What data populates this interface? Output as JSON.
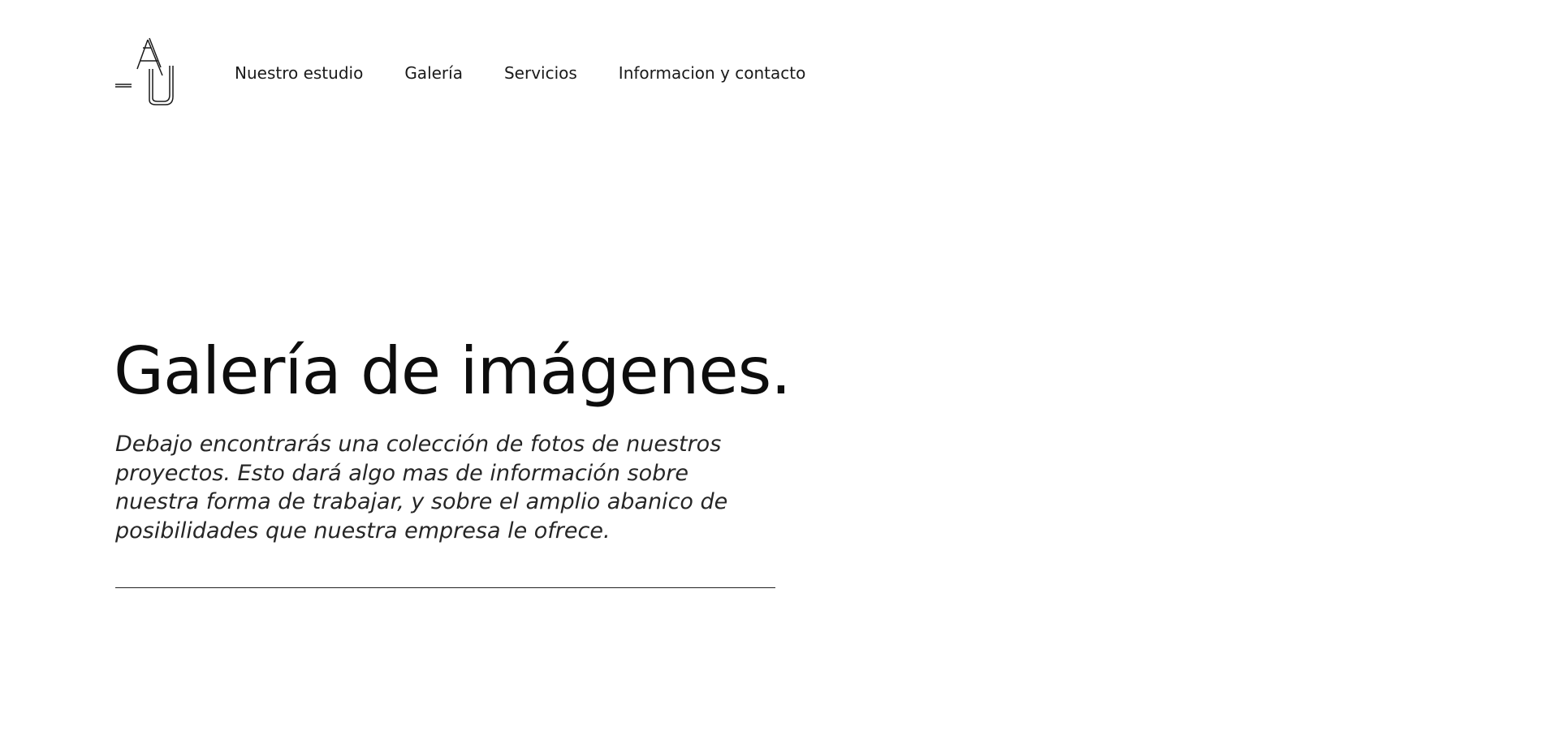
{
  "header": {
    "logo_icon": "aj-monogram-logo",
    "nav": [
      {
        "label": "Nuestro estudio"
      },
      {
        "label": "Galería"
      },
      {
        "label": "Servicios"
      },
      {
        "label": "Informacion y contacto"
      }
    ]
  },
  "hero": {
    "title": "Galería de imágenes.",
    "description": "Debajo encontrarás una colección de fotos de nuestros proyectos. Esto dará algo mas de información sobre nuestra forma de trabajar, y sobre el amplio abanico de posibilidades que nuestra empresa le ofrece."
  },
  "colors": {
    "background": "#ffffff",
    "text": "#111111"
  }
}
